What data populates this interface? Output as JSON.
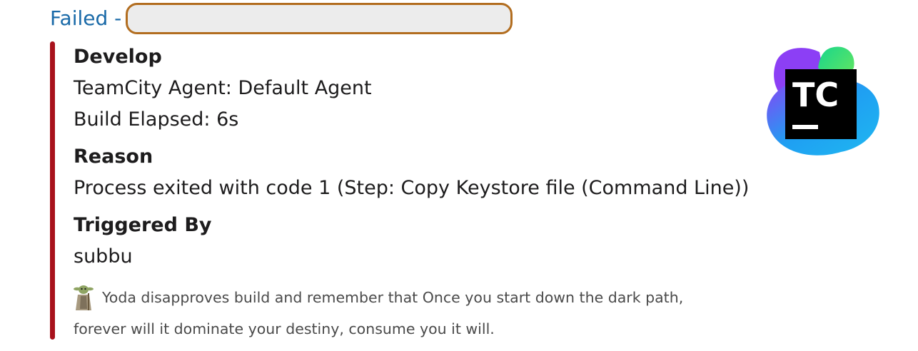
{
  "header": {
    "title": "Failed -",
    "redacted_value": ""
  },
  "colors": {
    "link": "#1a6aa8",
    "attachment_bar": "#a8121c",
    "redaction_border": "#b26d1f",
    "redaction_fill": "#ececec",
    "footer_text": "#4a4a4a"
  },
  "fields": {
    "project_title": "Develop",
    "agent": "TeamCity Agent: Default Agent",
    "elapsed": "Build Elapsed: 6s",
    "reason_title": "Reason",
    "reason": "Process exited with code 1 (Step: Copy Keystore file (Command Line))",
    "triggered_title": "Triggered By",
    "triggered_by": "subbu"
  },
  "footer": {
    "icon": "yoda-icon",
    "line1": "Yoda disapproves build and remember that Once you start down the dark path,",
    "line2": "forever will it dominate your destiny, consume you it will."
  },
  "thumb": {
    "icon": "teamcity-logo-icon",
    "logo_text": "TC"
  }
}
